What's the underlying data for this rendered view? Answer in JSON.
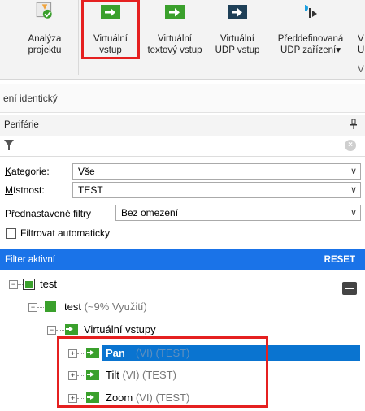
{
  "ribbon": {
    "buttons": [
      {
        "name": "analyza-projektu-button",
        "label1": "Analýza",
        "label2": "projektu"
      },
      {
        "name": "virtualni-vstup-button",
        "label1": "Virtuální",
        "label2": "vstup"
      },
      {
        "name": "virtualni-textovy-vstup-button",
        "label1": "Virtuální",
        "label2": "textový vstup"
      },
      {
        "name": "virtualni-udp-vstup-button",
        "label1": "Virtuální",
        "label2": "UDP vstup"
      },
      {
        "name": "preddefinovana-udp-button",
        "label1": "Předdefinovaná",
        "label2": "UDP zařízení▾"
      }
    ],
    "cut_label1": "V",
    "cut_label2": "UI",
    "group_label": "V"
  },
  "ident_text": "ení identický",
  "panel": {
    "title": "Periférie",
    "pin": "ꟷ",
    "clear": "×"
  },
  "filters": {
    "kategorie_label_u": "K",
    "kategorie_label_rest": "ategorie:",
    "kategorie_value": "Vše",
    "mistnost_label_u": "M",
    "mistnost_label_rest": "ístnost:",
    "mistnost_value": "TEST",
    "preset_label": "Přednastavené filtry",
    "preset_value": "Bez omezení",
    "auto_filter_label": "Filtrovat automaticky",
    "arrow": "∨"
  },
  "filter_bar": {
    "status": "Filter aktivní",
    "reset": "RESET"
  },
  "tree": {
    "root": {
      "label": "test"
    },
    "device": {
      "label": "test",
      "detail": "(~9% Využití)"
    },
    "group": {
      "label": "Virtuální vstupy"
    },
    "items": [
      {
        "label": "Pan",
        "detail": "(VI) (TEST)"
      },
      {
        "label": "Tilt",
        "detail": "(VI) (TEST)"
      },
      {
        "label": "Zoom",
        "detail": "(VI) (TEST)"
      }
    ]
  },
  "colors": {
    "accent": "#1a73e8",
    "highlight": "#e52020",
    "green": "#3aa02c",
    "selected": "#0a74d0"
  }
}
